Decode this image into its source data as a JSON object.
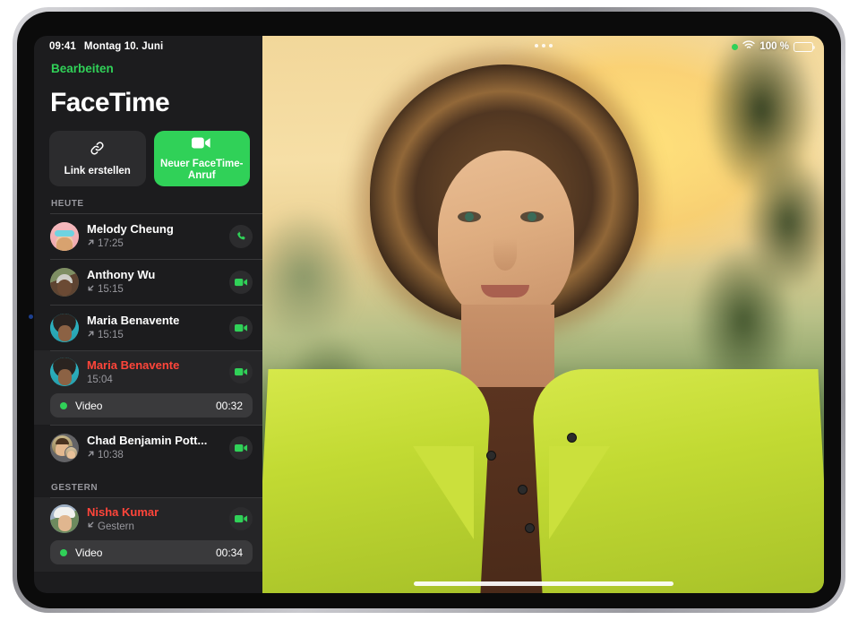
{
  "device": {
    "name": "iPad"
  },
  "status_bar": {
    "time": "09:41",
    "date": "Montag 10. Juni",
    "battery_percent": "100 %",
    "wifi_icon": "wifi-icon",
    "recording_dot_color": "#30d158",
    "battery_icon": "battery-full-icon"
  },
  "sidebar": {
    "edit_label": "Bearbeiten",
    "app_title": "FaceTime",
    "actions": [
      {
        "label": "Link erstellen",
        "icon": "link-icon",
        "style": "grey"
      },
      {
        "label": "Neuer FaceTime-Anruf",
        "icon": "video-camera-icon",
        "style": "green"
      }
    ],
    "sections": [
      {
        "header": "HEUTE",
        "calls": [
          {
            "name": "Melody Cheung",
            "time": "17:25",
            "direction": "outgoing",
            "direction_icon": "arrow-up-right-icon",
            "missed": false,
            "action_icon": "phone-icon",
            "expanded": false,
            "avatar_kind": "memoji",
            "avatar_color": "#f4b9bd"
          },
          {
            "name": "Anthony Wu",
            "time": "15:15",
            "direction": "incoming",
            "direction_icon": "arrow-down-left-icon",
            "missed": false,
            "action_icon": "video-camera-icon",
            "expanded": false,
            "avatar_kind": "photo",
            "avatar_color": "#6d7a5a"
          },
          {
            "name": "Maria Benavente",
            "time": "15:15",
            "direction": "outgoing",
            "direction_icon": "arrow-up-right-icon",
            "missed": false,
            "action_icon": "video-camera-icon",
            "expanded": false,
            "avatar_kind": "photo",
            "avatar_color": "#2fb8c6"
          },
          {
            "name": "Maria Benavente",
            "time": "15:04",
            "direction": "none",
            "direction_icon": "",
            "missed": true,
            "action_icon": "video-camera-icon",
            "expanded": true,
            "avatar_kind": "photo",
            "avatar_color": "#2fb8c6",
            "detail": {
              "type": "Video",
              "duration": "00:32",
              "dot_color": "#30d158"
            }
          },
          {
            "name": "Chad Benjamin Pott...",
            "time": "10:38",
            "direction": "outgoing",
            "direction_icon": "arrow-up-right-icon",
            "missed": false,
            "action_icon": "video-camera-icon",
            "expanded": false,
            "avatar_kind": "group",
            "avatar_color": "#636366"
          }
        ]
      },
      {
        "header": "GESTERN",
        "calls": [
          {
            "name": "Nisha Kumar",
            "time": "Gestern",
            "direction": "incoming",
            "direction_icon": "arrow-down-left-icon",
            "missed": true,
            "action_icon": "video-camera-icon",
            "expanded": true,
            "avatar_kind": "photo",
            "avatar_color": "#8a9ab0",
            "detail": {
              "type": "Video",
              "duration": "00:34",
              "dot_color": "#30d158"
            }
          }
        ]
      }
    ]
  },
  "video_pane": {
    "multitask_handle": "multitasking-dots",
    "home_indicator": "home-indicator",
    "description": "FaceTime video of a person with curly hair in a lime green jacket at sunset"
  },
  "colors": {
    "accent_green": "#30d158",
    "missed_red": "#ff453a",
    "sidebar_bg": "#1c1c1e",
    "row_expanded_bg": "#252527",
    "card_bg": "#3a3a3c",
    "secondary_text": "#98989e"
  }
}
